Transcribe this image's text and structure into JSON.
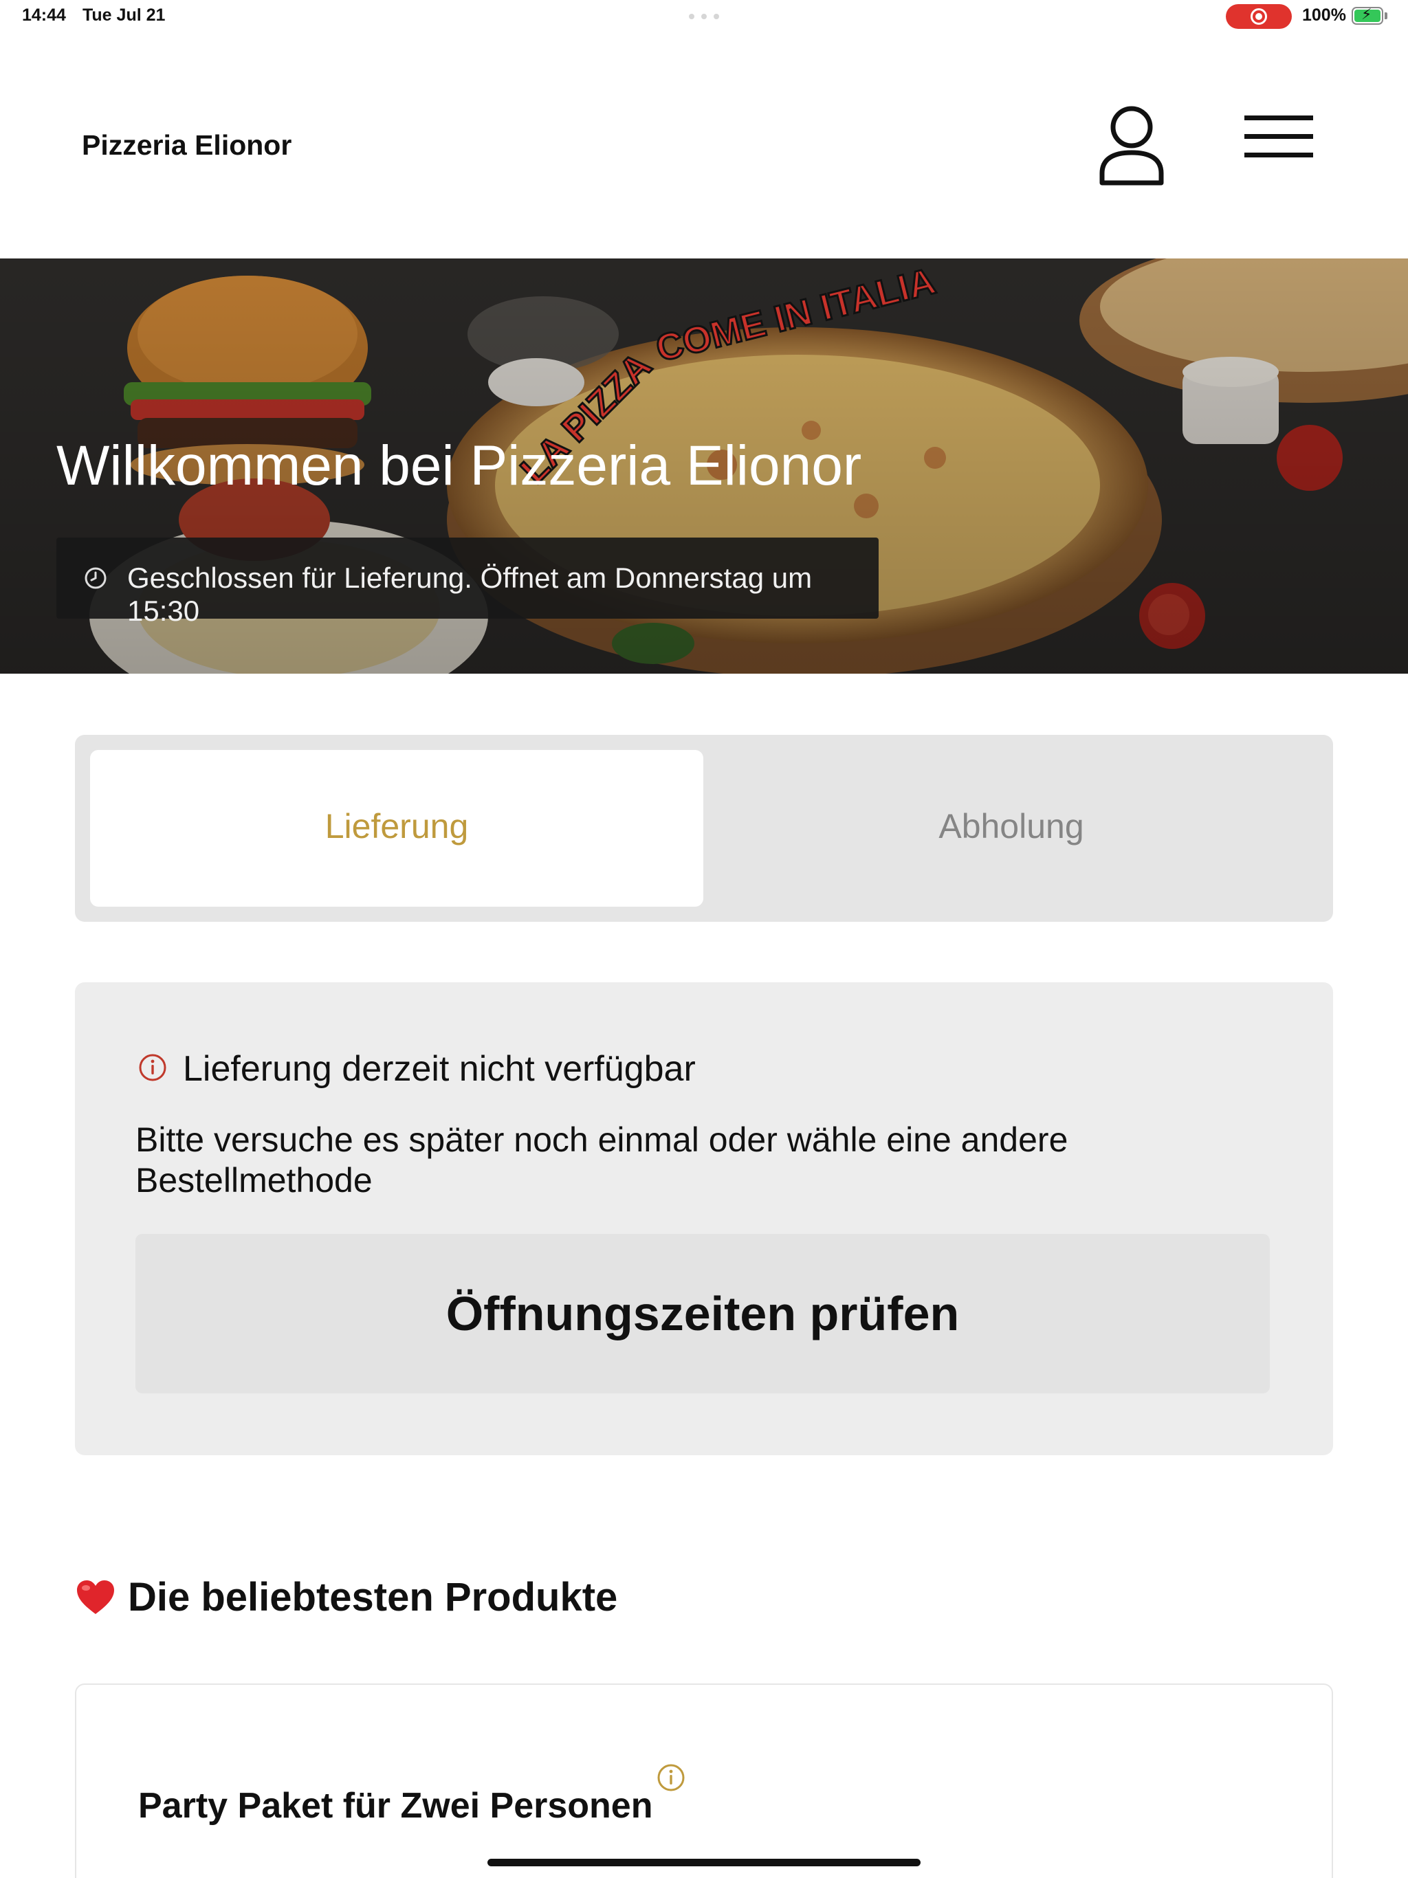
{
  "status_bar": {
    "time": "14:44",
    "date": "Tue Jul 21",
    "battery": "100%"
  },
  "header": {
    "brand": "Pizzeria Elionor"
  },
  "hero": {
    "title": "Willkommen bei Pizzeria Elionor",
    "status": "Geschlossen für Lieferung. Öffnet am Donnerstag um 15:30",
    "image_text": "LA PIZZA COME IN ITALIA"
  },
  "order_mode": {
    "options": [
      "Lieferung",
      "Abholung"
    ],
    "selected": "Lieferung"
  },
  "notice": {
    "title": "Lieferung derzeit nicht verfügbar",
    "body": "Bitte versuche es später noch einmal oder wähle eine andere Bestellmethode",
    "button": "Öffnungszeiten prüfen"
  },
  "popular": {
    "title": "Die beliebtesten Produkte",
    "products": [
      {
        "name": "Party Paket für Zwei Personen"
      }
    ]
  },
  "colors": {
    "accent": "#bf9a3d",
    "alert": "#c0392b",
    "panel": "#ededed"
  }
}
